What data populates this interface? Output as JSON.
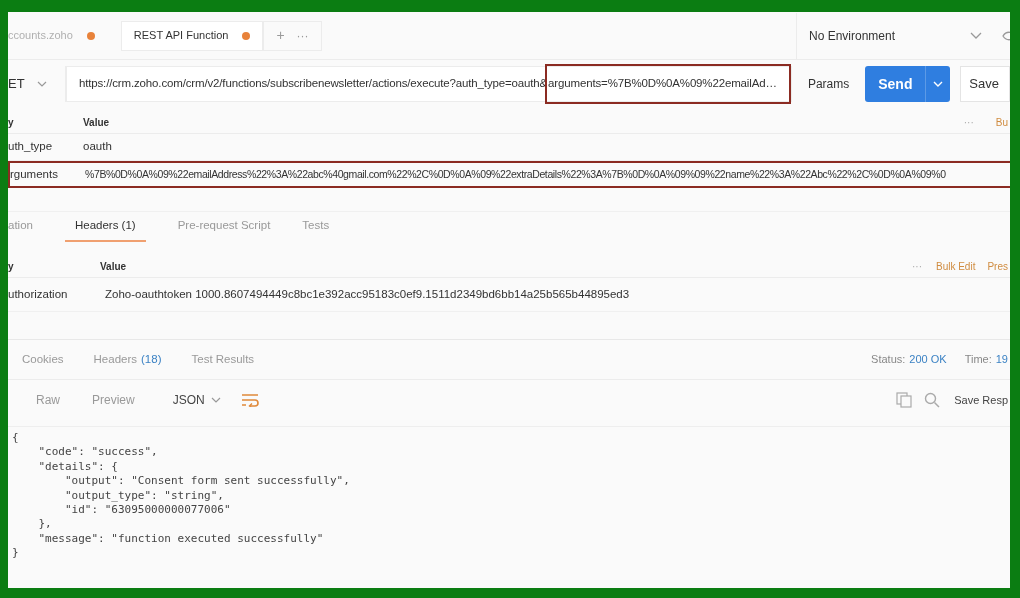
{
  "tabs": [
    {
      "label": "ccounts.zoho",
      "selected": false,
      "unsaved": true
    },
    {
      "label": "REST API Function",
      "selected": true,
      "unsaved": true
    }
  ],
  "tab_actions": {
    "add": "+",
    "more": "···"
  },
  "environment": {
    "label": "No Environment"
  },
  "request": {
    "method": "ET",
    "url_prefix": "https://crm.zoho.com/crm/v2/functions/subscribenewsletter/actions/execute?auth_type=oauth&",
    "url_highlighted": "arguments=%7B%0D%0A%09%22emailAd…",
    "params_button": "Params",
    "send_button": "Send",
    "save_button": "Save"
  },
  "params_table": {
    "columns": [
      "y",
      "Value"
    ],
    "more": "···",
    "bulk_edit": "Bu",
    "rows": [
      {
        "key": "uth_type",
        "value": "oauth",
        "highlighted": false
      },
      {
        "key": "rguments",
        "value": "%7B%0D%0A%09%22emailAddress%22%3A%22abc%40gmail.com%22%2C%0D%0A%09%22extraDetails%22%3A%7B%0D%0A%09%09%22name%22%3A%22Abc%22%2C%0D%0A%09%0",
        "highlighted": true
      }
    ]
  },
  "request_tabs": [
    {
      "label": "ation",
      "selected": false
    },
    {
      "label": "Headers (1)",
      "selected": true
    },
    {
      "label": "Pre-request Script",
      "selected": false
    },
    {
      "label": "Tests",
      "selected": false
    }
  ],
  "headers_table": {
    "columns": [
      "y",
      "Value"
    ],
    "more": "···",
    "bulk_edit": "Bulk Edit",
    "presets": "Pres",
    "rows": [
      {
        "key": "uthorization",
        "value": "Zoho-oauthtoken 1000.8607494449c8bc1e392acc95183c0ef9.1511d2349bd6bb14a25b565b44895ed3"
      }
    ]
  },
  "response_tabs": [
    {
      "label": "Cookies"
    },
    {
      "label": "Headers",
      "count": "(18)"
    },
    {
      "label": "Test Results"
    }
  ],
  "status": {
    "label": "Status:",
    "value": "200 OK"
  },
  "time": {
    "label": "Time:",
    "value": "19"
  },
  "format_bar": {
    "modes": [
      "Raw",
      "Preview"
    ],
    "format": "JSON",
    "save_response": "Save Resp"
  },
  "response_body": [
    "{",
    "    \"code\": \"success\",",
    "    \"details\": {",
    "        \"output\": \"Consent form sent successfully\",",
    "        \"output_type\": \"string\",",
    "        \"id\": \"63095000000077006\"",
    "    },",
    "    \"message\": \"function executed successfully\"",
    "}"
  ]
}
